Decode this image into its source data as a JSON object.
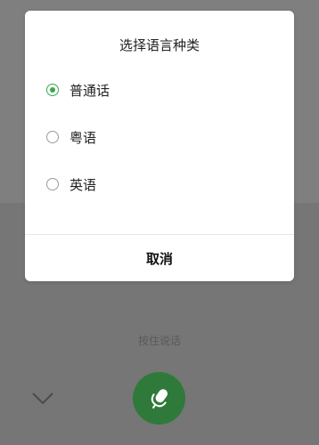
{
  "dialog": {
    "title": "选择语言种类",
    "options": [
      {
        "label": "普通话",
        "selected": true
      },
      {
        "label": "粤语",
        "selected": false
      },
      {
        "label": "英语",
        "selected": false
      }
    ],
    "cancel_label": "取消"
  },
  "voice": {
    "hint": "按住说话",
    "mic_icon": "mic-icon",
    "collapse_icon": "chevron-down-icon"
  },
  "colors": {
    "accent": "#39a94a",
    "mic_button": "#2f7a3a"
  }
}
